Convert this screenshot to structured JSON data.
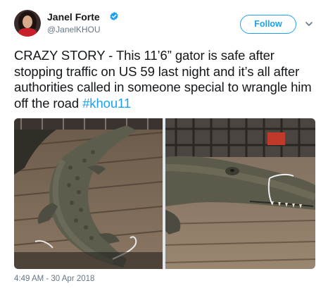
{
  "tweet": {
    "author_name": "Janel Forte",
    "author_handle": "@JanelKHOU",
    "verified": true,
    "follow_label": "Follow",
    "text_main": "CRAZY STORY - This 11’6” gator is safe after stopping traffic on US 59 last night and it’s all after authorities called in someone special to wrangle him off the road ",
    "hashtag": "#khou11",
    "timestamp": "4:49 AM - 30 Apr 2018"
  },
  "icons": {
    "verified": "verified-badge-icon",
    "chevron": "chevron-down-icon"
  },
  "colors": {
    "accent": "#1da1f2",
    "text": "#14171a",
    "secondary": "#657786"
  },
  "media": {
    "count": 2
  }
}
